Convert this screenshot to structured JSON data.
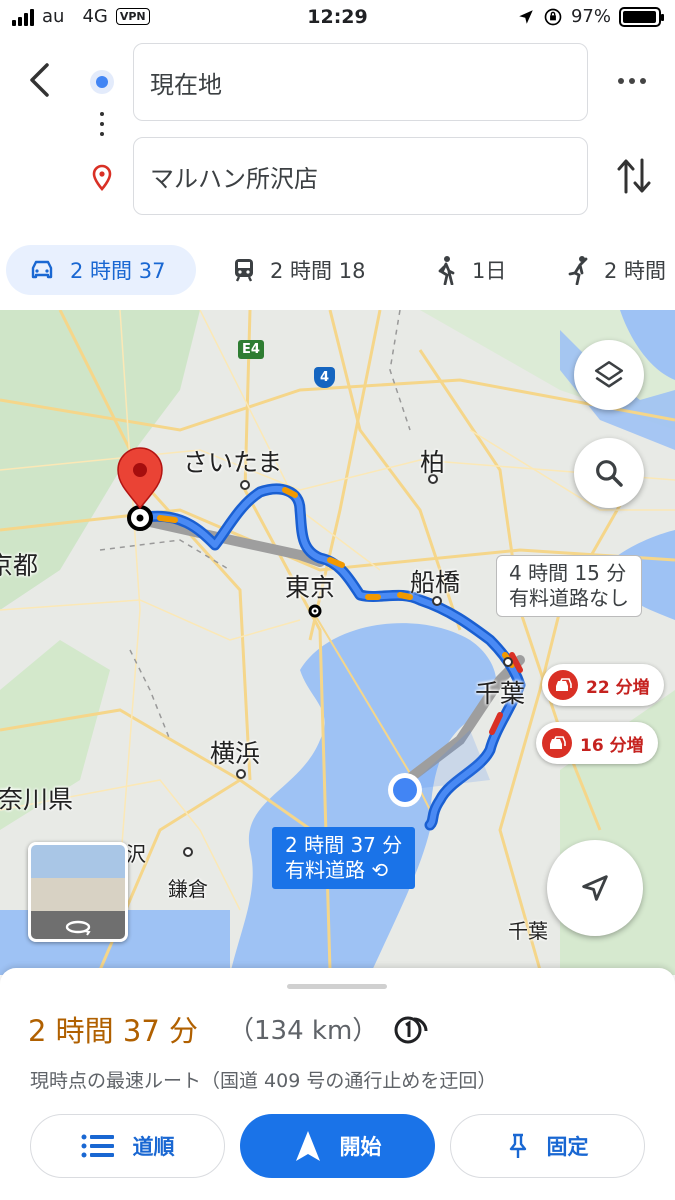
{
  "status": {
    "carrier": "au",
    "network": "4G",
    "vpn": "VPN",
    "time": "12:29",
    "battery": "97%",
    "battery_level": 0.97
  },
  "directions": {
    "origin": "現在地",
    "destination": "マルハン所沢店"
  },
  "modes": [
    {
      "label": "2 時間 37",
      "icon": "car-icon",
      "active": true
    },
    {
      "label": "2 時間 18",
      "icon": "transit-icon",
      "active": false
    },
    {
      "label": "1日",
      "icon": "walk-icon",
      "active": false
    },
    {
      "label": "2 時間",
      "icon": "rideshare-icon",
      "active": false
    }
  ],
  "map": {
    "places": {
      "saitama": "さいたま",
      "kashiwa": "柏",
      "tokyo": "東京",
      "funabashi": "船橋",
      "chiba": "千葉",
      "yokohama": "横浜",
      "kamakura": "鎌倉",
      "tokyo_to": "京都",
      "kanagawa": "奈川県",
      "fujisawa": "沢",
      "chiba_ken": "千葉"
    },
    "shields": {
      "e4": "E4",
      "route4": "4"
    },
    "alt_route": {
      "line1": "4 時間 15 分",
      "line2": "有料道路なし"
    },
    "main_route": {
      "line1": "2 時間 37 分",
      "line2": "有料道路"
    },
    "traffic": [
      {
        "label": "22 分増"
      },
      {
        "label": "16 分増"
      }
    ]
  },
  "summary": {
    "duration": "2 時間 37 分",
    "distance": "（134 km）",
    "description": "現時点の最速ルート（国道 409 号の通行止めを迂回）"
  },
  "actions": {
    "steps": "道順",
    "start": "開始",
    "pin": "固定"
  }
}
